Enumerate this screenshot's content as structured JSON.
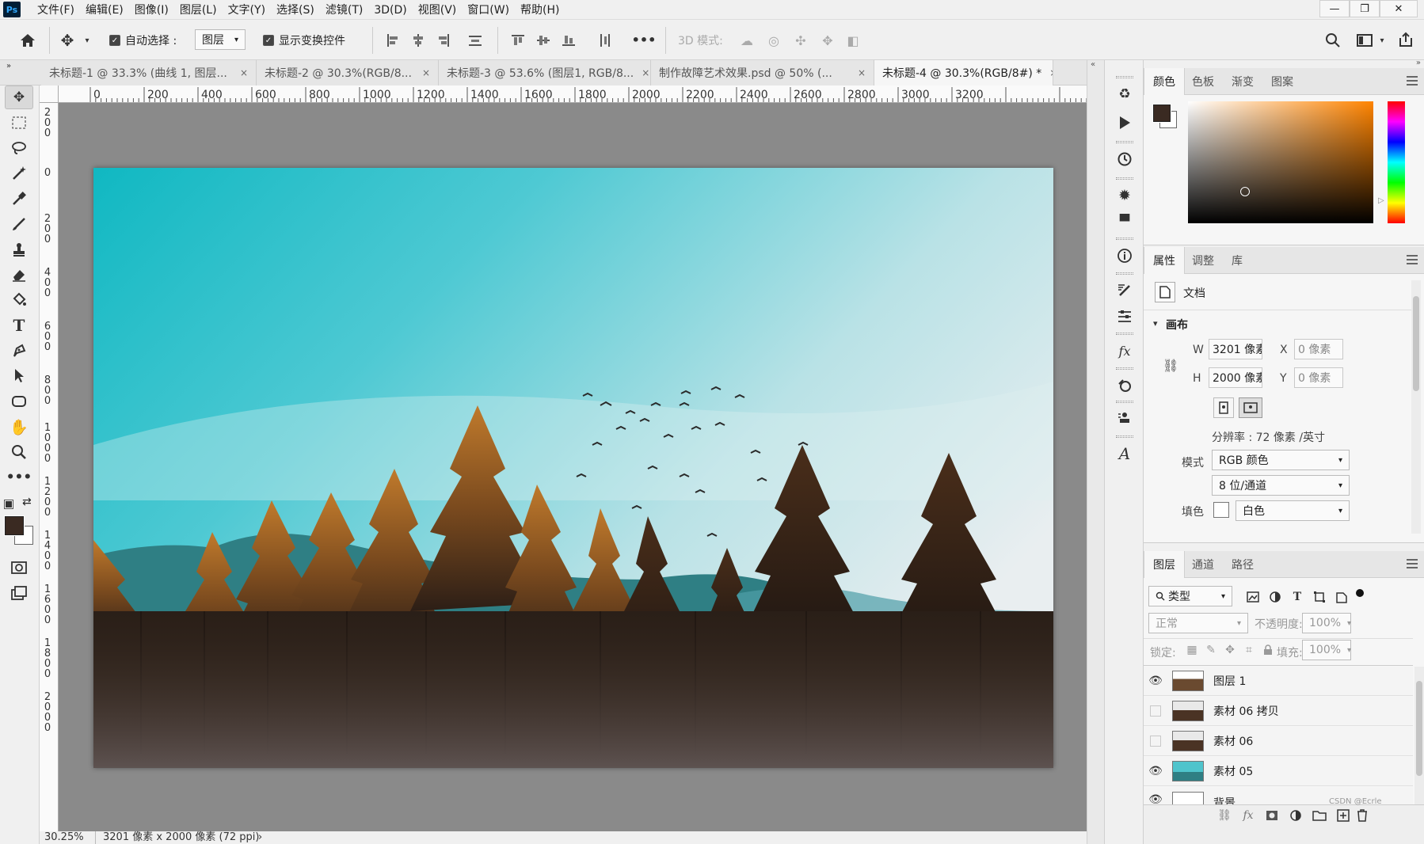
{
  "app": {
    "logo": "Ps"
  },
  "menu": [
    "文件(F)",
    "编辑(E)",
    "图像(I)",
    "图层(L)",
    "文字(Y)",
    "选择(S)",
    "滤镜(T)",
    "3D(D)",
    "视图(V)",
    "窗口(W)",
    "帮助(H)"
  ],
  "window_controls": {
    "minimize": "—",
    "restore": "❐",
    "close": "✕"
  },
  "options": {
    "auto_select_label": "自动选择 :",
    "auto_select_value": "图层",
    "show_transform_label": "显示变换控件",
    "more": "•••",
    "mode3d_label": "3D 模式:"
  },
  "tabs": [
    {
      "label": "未标题-1 @ 33.3% (曲线 1, 图层...",
      "close": "×"
    },
    {
      "label": "未标题-2 @ 30.3%(RGB/8...",
      "close": "×"
    },
    {
      "label": "未标题-3 @ 53.6% (图层1, RGB/8...",
      "close": "×"
    },
    {
      "label": "制作故障艺术效果.psd @ 50% (...",
      "close": "×"
    },
    {
      "label": "未标题-4 @ 30.3%(RGB/8#) *",
      "close": "×"
    }
  ],
  "ruler": {
    "top_ticks": [
      "0",
      "200",
      "400",
      "600",
      "800",
      "1000",
      "1200",
      "1400",
      "1600",
      "1800",
      "2000",
      "2200",
      "2400",
      "2600",
      "2800",
      "3000",
      "3200"
    ],
    "left_ticks": [
      "200",
      "0",
      "200",
      "400",
      "600",
      "800",
      "1000",
      "1200",
      "1400",
      "1600",
      "1800",
      "2000"
    ]
  },
  "status": {
    "zoom": "30.25%",
    "info": "3201 像素 x 2000 像素 (72 ppi)",
    "arrow": "›"
  },
  "color_panel": {
    "tabs": [
      "颜色",
      "色板",
      "渐变",
      "图案"
    ],
    "foreground": "#3a2a22",
    "background": "#ffffff",
    "picker_hue": "#ff8400"
  },
  "properties_panel": {
    "tabs": [
      "属性",
      "调整",
      "库"
    ],
    "doc_label": "文档",
    "section": "画布",
    "w_label": "W",
    "w_value": "3201 像素",
    "h_label": "H",
    "h_value": "2000 像素",
    "x_label": "X",
    "x_value": "0 像素",
    "y_label": "Y",
    "y_value": "0 像素",
    "resolution": "分辨率 : 72 像素 /英寸",
    "mode_label": "模式",
    "mode_value": "RGB 颜色",
    "depth_value": "8 位/通道",
    "fill_label": "填色",
    "fill_value": "白色"
  },
  "layers_panel": {
    "tabs": [
      "图层",
      "通道",
      "路径"
    ],
    "filter_value": "类型",
    "blend_mode": "正常",
    "opacity_label": "不透明度:",
    "opacity_value": "100%",
    "lock_label": "锁定:",
    "fill_label": "填充:",
    "fill_value": "100%",
    "layers": [
      {
        "name": "图层 1",
        "visible": true
      },
      {
        "name": "素材 06 拷贝",
        "visible": false
      },
      {
        "name": "素材 06",
        "visible": false
      },
      {
        "name": "素材 05",
        "visible": true
      },
      {
        "name": "背景",
        "visible": true
      }
    ],
    "watermark": "CSDN @Ecrle"
  }
}
